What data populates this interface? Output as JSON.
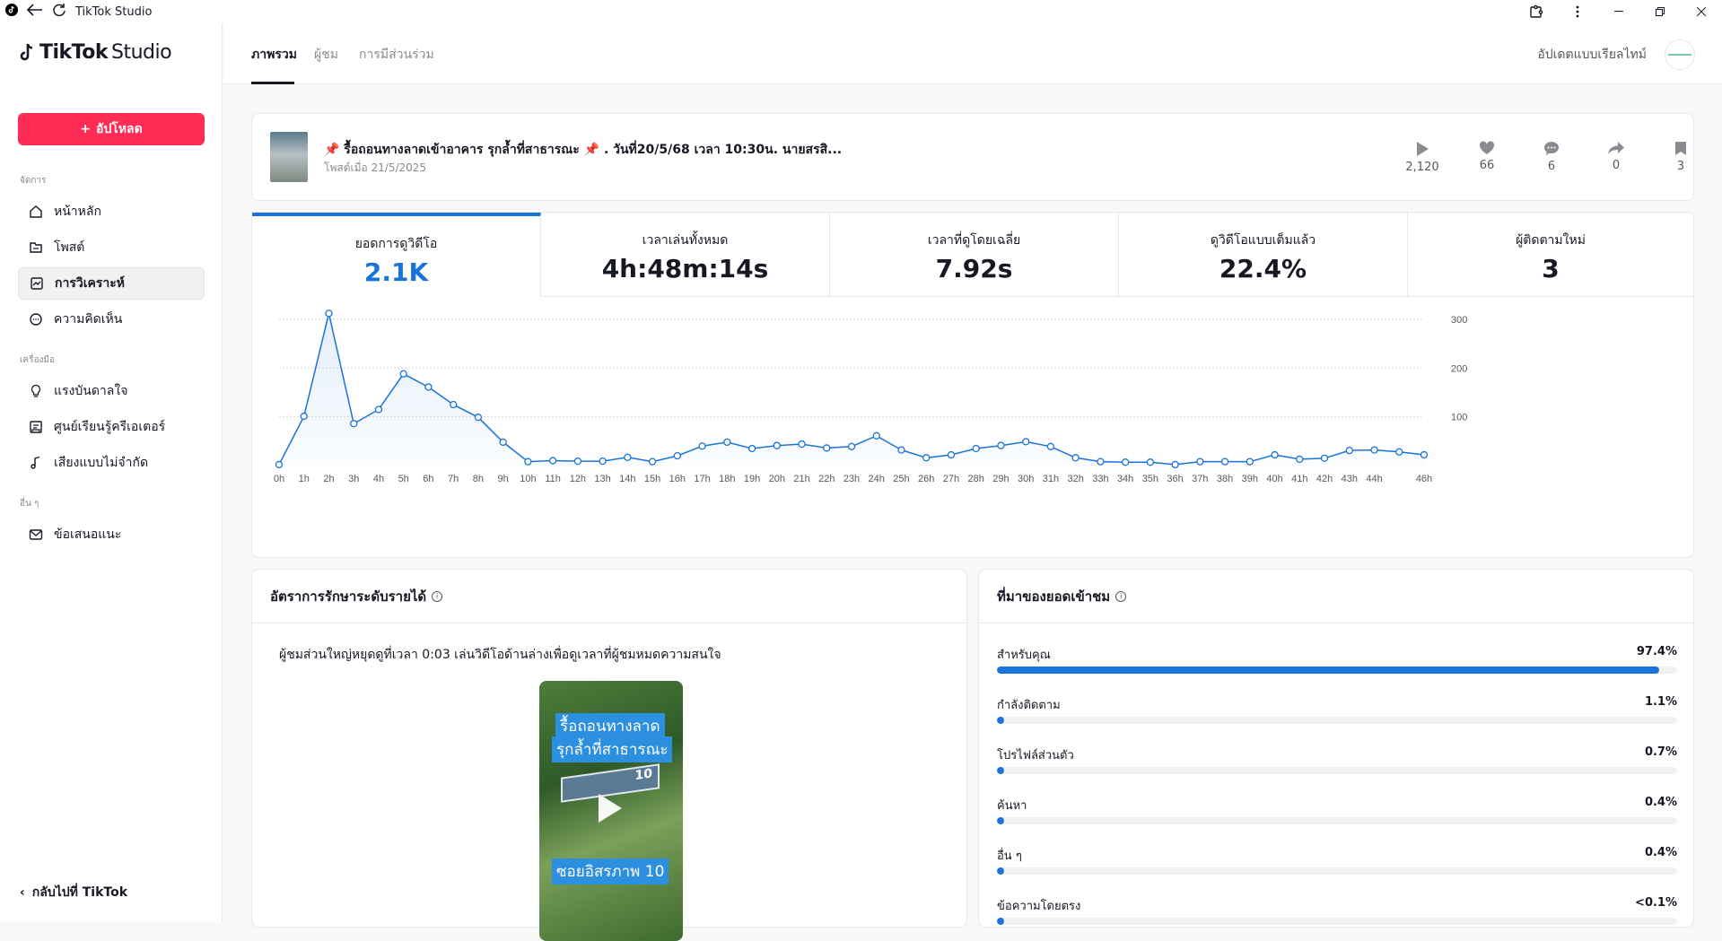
{
  "window": {
    "title": "TikTok Studio"
  },
  "sidebar": {
    "logo_main": "TikTok",
    "logo_studio": "Studio",
    "upload_label": "อัปโหลด",
    "sections": [
      {
        "title": "จัดการ",
        "items": [
          {
            "label": "หน้าหลัก",
            "icon": "home-icon"
          },
          {
            "label": "โพสต์",
            "icon": "posts-icon"
          },
          {
            "label": "การวิเคราะห์",
            "icon": "analytics-icon",
            "active": true
          },
          {
            "label": "ความคิดเห็น",
            "icon": "comment-icon"
          }
        ]
      },
      {
        "title": "เครื่องมือ",
        "items": [
          {
            "label": "แรงบันดาลใจ",
            "icon": "lightbulb-icon"
          },
          {
            "label": "ศูนย์เรียนรู้ครีเอเตอร์",
            "icon": "academy-icon"
          },
          {
            "label": "เสียงแบบไม่จำกัด",
            "icon": "music-icon"
          }
        ]
      },
      {
        "title": "อื่น ๆ",
        "items": [
          {
            "label": "ข้อเสนอแนะ",
            "icon": "mail-icon"
          }
        ]
      }
    ],
    "back_label": "กลับไปที่ TikTok"
  },
  "topbar": {
    "tabs": [
      "ภาพรวม",
      "ผู้ชม",
      "การมีส่วนร่วม"
    ],
    "active_tab": 0,
    "realtime_label": "อัปเดตแบบเรียลไทม์"
  },
  "post": {
    "title": "📌 รื้อถอนทางลาดเข้าอาคาร รุกล้ำที่สาธารณะ 📌 . วันที่20/5/68 เวลา 10:30น. นายสรสิ...",
    "date": "โพสต์เมื่อ 21/5/2025",
    "stats": [
      {
        "icon": "play-icon",
        "value": "2,120"
      },
      {
        "icon": "heart-icon",
        "value": "66"
      },
      {
        "icon": "comment-icon",
        "value": "6"
      },
      {
        "icon": "share-icon",
        "value": "0"
      },
      {
        "icon": "bookmark-icon",
        "value": "3"
      }
    ]
  },
  "metrics": [
    {
      "label": "ยอดการดูวิดีโอ",
      "value": "2.1K",
      "active": true
    },
    {
      "label": "เวลาเล่นทั้งหมด",
      "value": "4h:48m:14s"
    },
    {
      "label": "เวลาที่ดูโดยเฉลี่ย",
      "value": "7.92s"
    },
    {
      "label": "ดูวิดีโอแบบเต็มแล้ว",
      "value": "22.4%"
    },
    {
      "label": "ผู้ติดตามใหม่",
      "value": "3"
    }
  ],
  "chart_data": {
    "type": "area",
    "x": [
      "0h",
      "1h",
      "2h",
      "3h",
      "4h",
      "5h",
      "6h",
      "7h",
      "8h",
      "9h",
      "10h",
      "11h",
      "12h",
      "13h",
      "14h",
      "15h",
      "16h",
      "17h",
      "18h",
      "19h",
      "20h",
      "21h",
      "22h",
      "23h",
      "24h",
      "25h",
      "26h",
      "27h",
      "28h",
      "29h",
      "30h",
      "31h",
      "32h",
      "33h",
      "34h",
      "35h",
      "36h",
      "37h",
      "38h",
      "39h",
      "40h",
      "41h",
      "42h",
      "43h",
      "44h",
      "45h",
      "46h"
    ],
    "x_tick_labels": [
      "0h",
      "1h",
      "2h",
      "3h",
      "4h",
      "5h",
      "6h",
      "7h",
      "8h",
      "9h",
      "10h",
      "11h",
      "12h",
      "13h",
      "14h",
      "15h",
      "16h",
      "17h",
      "18h",
      "19h",
      "20h",
      "21h",
      "22h",
      "23h",
      "24h",
      "25h",
      "26h",
      "27h",
      "28h",
      "29h",
      "30h",
      "31h",
      "32h",
      "33h",
      "34h",
      "35h",
      "36h",
      "37h",
      "38h",
      "39h",
      "40h",
      "41h",
      "42h",
      "43h",
      "44h",
      "46h"
    ],
    "series": [
      {
        "values": [
          2,
          101,
          312,
          86,
          115,
          188,
          161,
          125,
          99,
          48,
          8,
          10,
          9,
          9,
          17,
          8,
          20,
          40,
          48,
          35,
          41,
          44,
          36,
          39,
          61,
          32,
          16,
          22,
          35,
          41,
          49,
          39,
          16,
          8,
          7,
          7,
          2,
          8,
          8,
          8,
          22,
          13,
          15,
          31,
          32,
          28,
          22
        ]
      }
    ],
    "y_ticks": [
      100,
      200,
      300
    ],
    "ylim": [
      0,
      320
    ],
    "grid": true,
    "y_axis_side": "right",
    "color": "#1a73d8"
  },
  "retention": {
    "title": "อัตราการรักษาระดับรายได้",
    "text": "ผู้ชมส่วนใหญ่หยุดดูที่เวลา 0:03 เล่นวิดีโอด้านล่างเพื่อดูเวลาที่ผู้ชมหมดความสนใจ",
    "video_caption_top_1": "รื้อถอนทางลาด",
    "video_caption_top_2": "รุกล้ำที่สาธารณะ",
    "video_sign_number": "10",
    "video_caption_bottom": "ซอยอิสรภาพ 10"
  },
  "traffic": {
    "title": "ที่มาของยอดเข้าชม",
    "sources": [
      {
        "label": "สำหรับคุณ",
        "value": "97.4%",
        "fraction": 0.974
      },
      {
        "label": "กำลังติดตาม",
        "value": "1.1%",
        "fraction": 0.011
      },
      {
        "label": "โปรไฟล์ส่วนตัว",
        "value": "0.7%",
        "fraction": 0.007
      },
      {
        "label": "ค้นหา",
        "value": "0.4%",
        "fraction": 0.004
      },
      {
        "label": "อื่น ๆ",
        "value": "0.4%",
        "fraction": 0.004
      },
      {
        "label": "ข้อความโดยตรง",
        "value": "<0.1%",
        "fraction": 0.001
      }
    ]
  }
}
